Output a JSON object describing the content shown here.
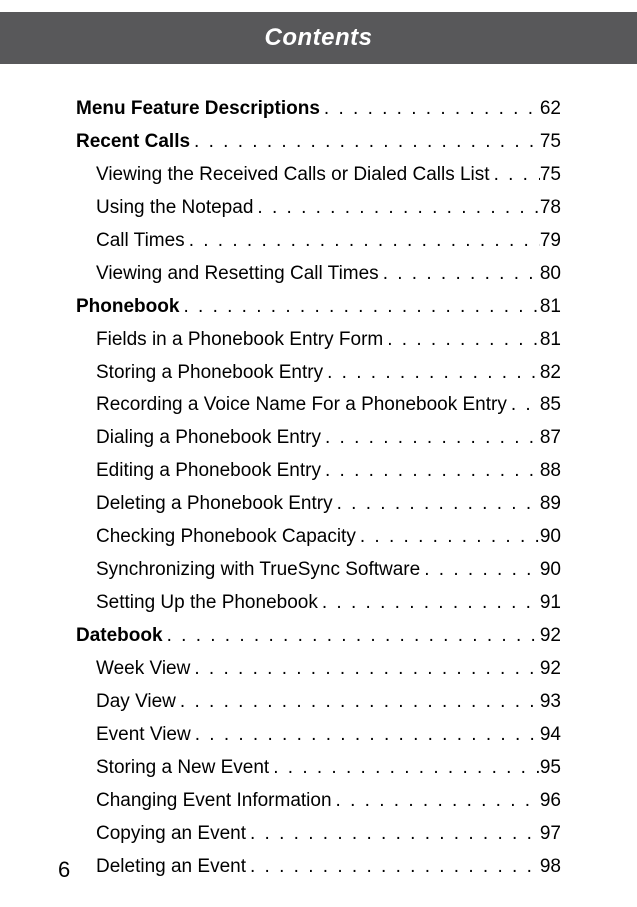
{
  "header": {
    "title": "Contents"
  },
  "toc": [
    {
      "level": "section",
      "title": "Menu Feature Descriptions",
      "page": "62"
    },
    {
      "level": "section",
      "title": "Recent Calls",
      "page": "75"
    },
    {
      "level": "sub",
      "title": "Viewing the Received Calls or Dialed Calls List",
      "page": "75"
    },
    {
      "level": "sub",
      "title": "Using the Notepad",
      "page": "78"
    },
    {
      "level": "sub",
      "title": "Call Times",
      "page": "79"
    },
    {
      "level": "sub",
      "title": "Viewing and Resetting Call Times",
      "page": "80"
    },
    {
      "level": "section",
      "title": "Phonebook",
      "page": "81"
    },
    {
      "level": "sub",
      "title": "Fields in a Phonebook Entry Form",
      "page": "81"
    },
    {
      "level": "sub",
      "title": "Storing a Phonebook Entry",
      "page": "82"
    },
    {
      "level": "sub",
      "title": "Recording a Voice Name For a Phonebook Entry",
      "page": "85"
    },
    {
      "level": "sub",
      "title": "Dialing a Phonebook Entry",
      "page": "87"
    },
    {
      "level": "sub",
      "title": "Editing a Phonebook Entry",
      "page": "88"
    },
    {
      "level": "sub",
      "title": "Deleting a Phonebook Entry",
      "page": "89"
    },
    {
      "level": "sub",
      "title": "Checking Phonebook Capacity",
      "page": "90"
    },
    {
      "level": "sub",
      "title": "Synchronizing with TrueSync Software",
      "page": "90"
    },
    {
      "level": "sub",
      "title": "Setting Up the Phonebook",
      "page": "91"
    },
    {
      "level": "section",
      "title": "Datebook",
      "page": "92"
    },
    {
      "level": "sub",
      "title": "Week View",
      "page": "92"
    },
    {
      "level": "sub",
      "title": "Day View",
      "page": "93"
    },
    {
      "level": "sub",
      "title": "Event View",
      "page": "94"
    },
    {
      "level": "sub",
      "title": "Storing a New Event",
      "page": "95"
    },
    {
      "level": "sub",
      "title": "Changing Event Information",
      "page": "96"
    },
    {
      "level": "sub",
      "title": "Copying an Event",
      "page": "97"
    },
    {
      "level": "sub",
      "title": "Deleting an Event",
      "page": "98"
    }
  ],
  "pageNumber": "6"
}
